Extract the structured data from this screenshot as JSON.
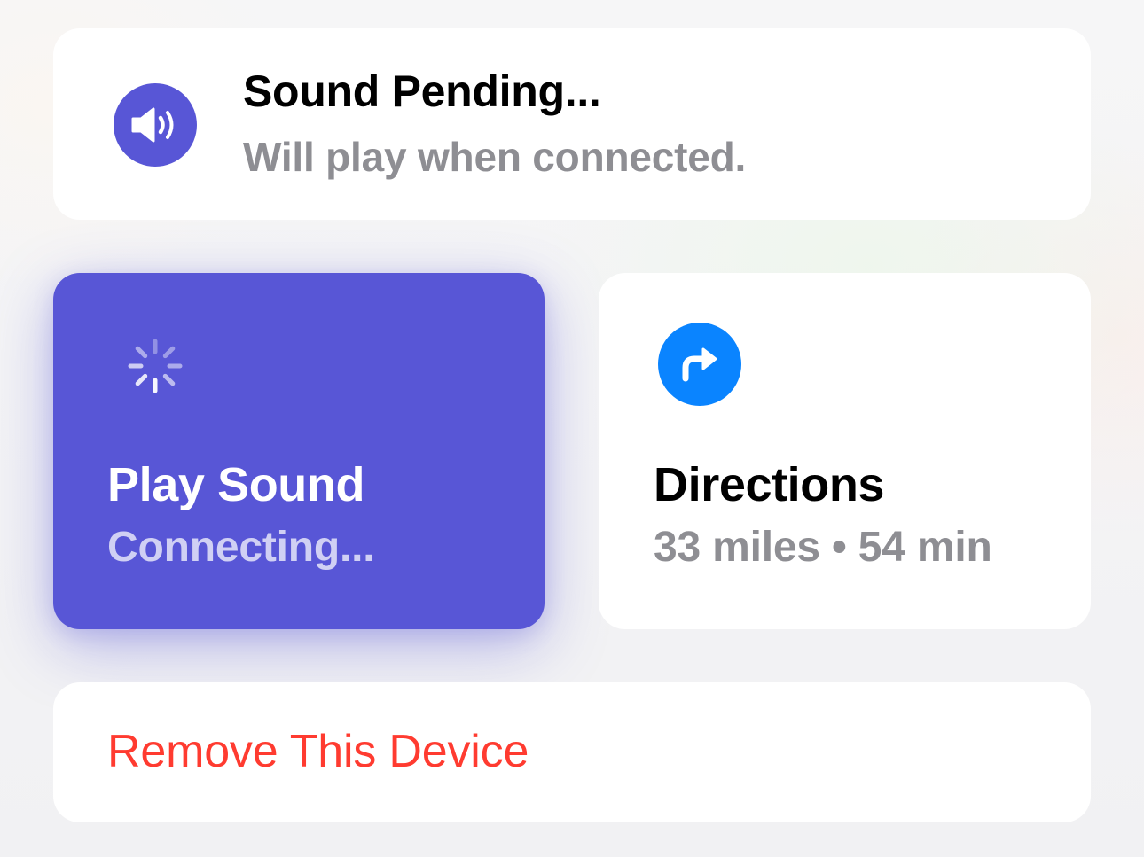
{
  "colors": {
    "sound_accent": "#5856d6",
    "directions_accent": "#0a84ff",
    "destructive": "#ff3b30",
    "secondary_text": "#8e8e93"
  },
  "pending": {
    "icon": "speaker-wave-icon",
    "title": "Sound Pending...",
    "subtitle": "Will play when connected."
  },
  "play_sound": {
    "icon": "activity-spinner-icon",
    "title": "Play Sound",
    "status": "Connecting..."
  },
  "directions": {
    "icon": "turn-right-arrow-icon",
    "title": "Directions",
    "detail": "33 miles • 54 min"
  },
  "remove": {
    "label": "Remove This Device"
  }
}
